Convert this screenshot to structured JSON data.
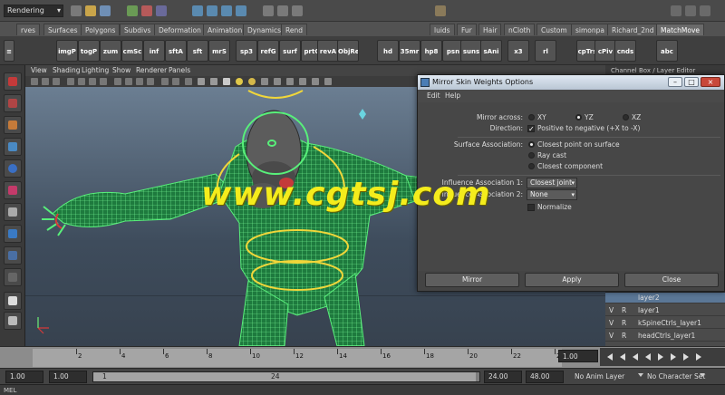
{
  "statusline": {
    "mode": "Rendering"
  },
  "shelf_tabs": [
    "rves",
    "Surfaces",
    "Polygons",
    "Subdivs",
    "Deformation",
    "Animation",
    "Dynamics",
    "Rend",
    "luids",
    "Fur",
    "Hair",
    "nCloth",
    "Custom",
    "simonpa",
    "Richard_2nd",
    "MatchMove"
  ],
  "shelf_active_tab": "MatchMove",
  "shelf_buttons": [
    "imgP",
    "togP",
    "zum",
    "cmSc",
    "inf",
    "sftA",
    "sft",
    "mrS",
    "sp3",
    "refG",
    "surf",
    "prtC",
    "revA",
    "ObjRe",
    "hd",
    "35mr",
    "hp8",
    "psn",
    "suns",
    "sAni",
    "x3",
    "rl",
    "cpTrs",
    "cPiv",
    "cnds",
    "abc"
  ],
  "viewport": {
    "menu": [
      "View",
      "Shading",
      "Lighting",
      "Show",
      "Renderer",
      "Panels"
    ]
  },
  "channel_box": {
    "header": "Channel Box / Layer Editor"
  },
  "layers": [
    {
      "v": "",
      "r": "",
      "name": "layer2"
    },
    {
      "v": "V",
      "r": "R",
      "name": "layer1"
    },
    {
      "v": "V",
      "r": "R",
      "name": "kSpineCtrls_layer1"
    },
    {
      "v": "V",
      "r": "R",
      "name": "headCtrls_layer1"
    }
  ],
  "dialog": {
    "title": "Mirror Skin Weights Options",
    "window_buttons": {
      "minimize": "–",
      "maximize": "□",
      "close": "×"
    },
    "menu": [
      "Edit",
      "Help"
    ],
    "mirror_across": {
      "label": "Mirror across:",
      "options": [
        "XY",
        "YZ",
        "XZ"
      ],
      "selected": "YZ"
    },
    "direction": {
      "label": "Direction:",
      "checked": true,
      "text": "Positive to negative (+X to -X)"
    },
    "surface_association": {
      "label": "Surface Association:",
      "options": [
        "Closest point on surface",
        "Ray cast",
        "Closest component"
      ],
      "selected": "Closest point on surface"
    },
    "influence_association_1": {
      "label": "Influence Association 1:",
      "value": "Closest joint"
    },
    "influence_association_2": {
      "label": "Influence Association 2:",
      "value": "None"
    },
    "normalize": {
      "label": "Normalize",
      "checked": false
    },
    "buttons": {
      "mirror": "Mirror",
      "apply": "Apply",
      "close": "Close"
    }
  },
  "timeline": {
    "ticks": [
      2,
      4,
      6,
      8,
      10,
      12,
      14,
      16,
      18,
      20,
      22,
      24
    ],
    "range_max": 24,
    "current_frame": "1.00"
  },
  "range_slider": {
    "start": "1.00",
    "start_inner": "1.00",
    "handle_left": "1",
    "handle_right": "24",
    "end_inner": "24.00",
    "end": "48.00",
    "anim_layer": "No Anim Layer",
    "character_set": "No Character Set"
  },
  "command_line": {
    "label": "MEL"
  },
  "watermark": "www.cgtsj.com"
}
